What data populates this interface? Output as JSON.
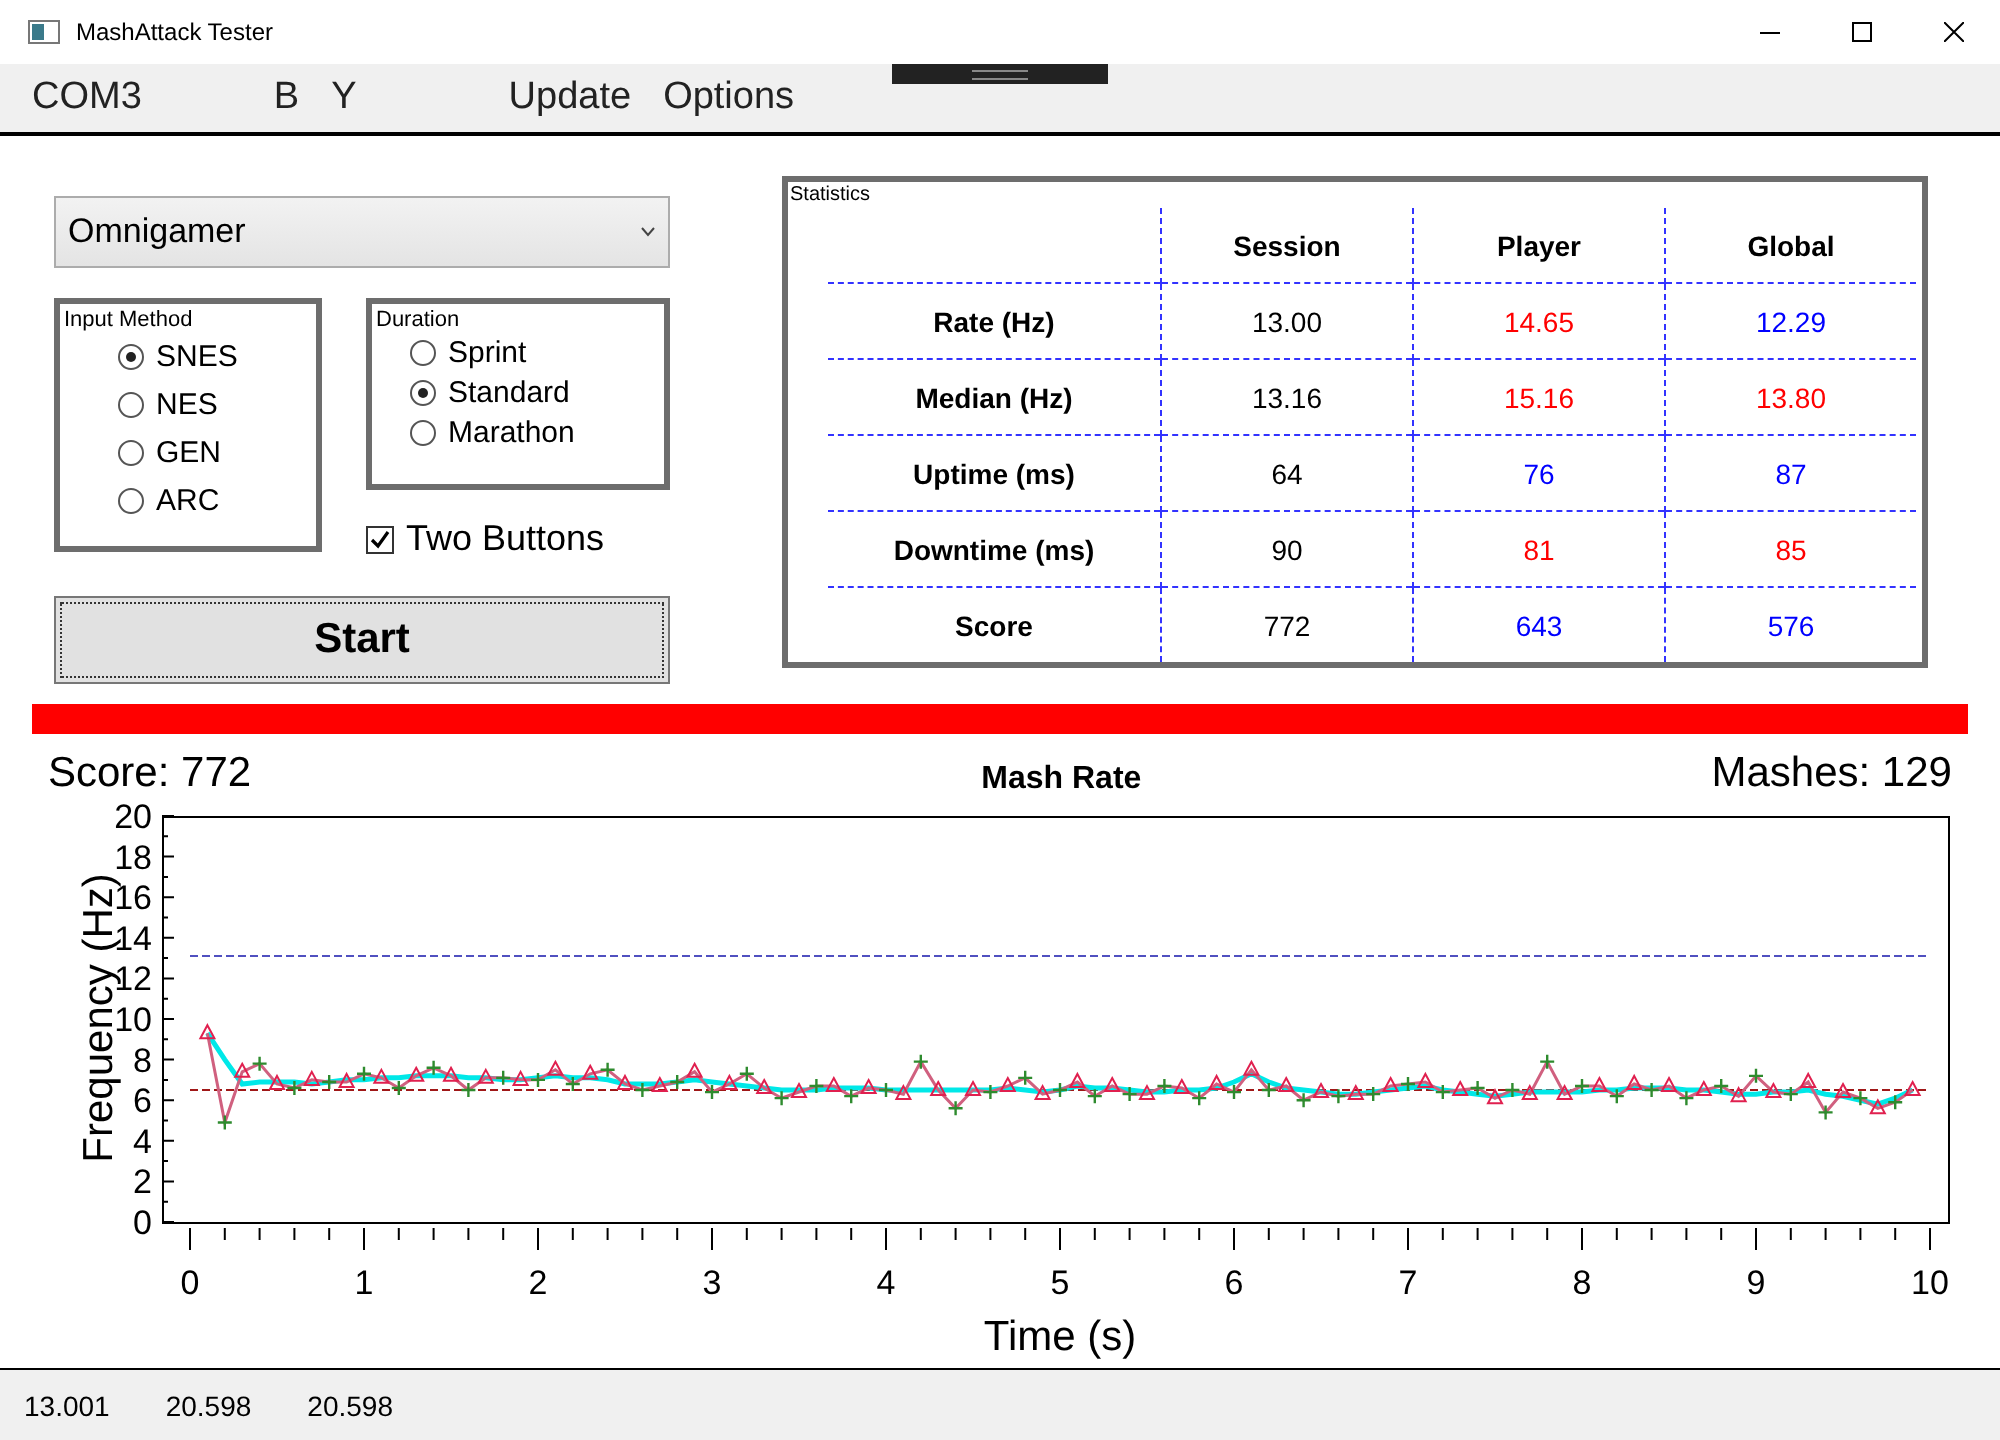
{
  "window": {
    "title": "MashAttack Tester"
  },
  "menu": [
    {
      "label": "COM3"
    },
    {
      "label": "B"
    },
    {
      "label": "Y"
    },
    {
      "label": "Update"
    },
    {
      "label": "Options"
    }
  ],
  "player_select": {
    "value": "Omnigamer"
  },
  "input_method": {
    "title": "Input Method",
    "options": [
      {
        "label": "SNES",
        "selected": true
      },
      {
        "label": "NES",
        "selected": false
      },
      {
        "label": "GEN",
        "selected": false
      },
      {
        "label": "ARC",
        "selected": false
      }
    ]
  },
  "duration": {
    "title": "Duration",
    "options": [
      {
        "label": "Sprint",
        "selected": false
      },
      {
        "label": "Standard",
        "selected": true
      },
      {
        "label": "Marathon",
        "selected": false
      }
    ]
  },
  "two_buttons": {
    "label": "Two Buttons",
    "checked": true
  },
  "start_button": {
    "label": "Start"
  },
  "statistics": {
    "title": "Statistics",
    "columns": [
      "Session",
      "Player",
      "Global"
    ],
    "rows": [
      {
        "label": "Rate (Hz)",
        "cells": [
          {
            "text": "13.00",
            "color": "#000000"
          },
          {
            "text": "14.65",
            "color": "#ff0000"
          },
          {
            "text": "12.29",
            "color": "#0000ff"
          }
        ]
      },
      {
        "label": "Median (Hz)",
        "cells": [
          {
            "text": "13.16",
            "color": "#000000"
          },
          {
            "text": "15.16",
            "color": "#ff0000"
          },
          {
            "text": "13.80",
            "color": "#ff0000"
          }
        ]
      },
      {
        "label": "Uptime (ms)",
        "cells": [
          {
            "text": "64",
            "color": "#000000"
          },
          {
            "text": "76",
            "color": "#0000ff"
          },
          {
            "text": "87",
            "color": "#0000ff"
          }
        ]
      },
      {
        "label": "Downtime (ms)",
        "cells": [
          {
            "text": "90",
            "color": "#000000"
          },
          {
            "text": "81",
            "color": "#ff0000"
          },
          {
            "text": "85",
            "color": "#ff0000"
          }
        ]
      },
      {
        "label": "Score",
        "cells": [
          {
            "text": "772",
            "color": "#000000"
          },
          {
            "text": "643",
            "color": "#0000ff"
          },
          {
            "text": "576",
            "color": "#0000ff"
          }
        ]
      }
    ]
  },
  "progress": {
    "level": 1
  },
  "chart": {
    "score": "Score: 772",
    "mashes": "Mashes: 129",
    "chart_data": {
      "type": "line",
      "title": "Mash Rate",
      "xlabel": "Time (s)",
      "ylabel": "Frequency (Hz)",
      "xlim": [
        0,
        10
      ],
      "ylim": [
        0,
        20
      ],
      "xticks": [
        0,
        1,
        2,
        3,
        4,
        5,
        6,
        7,
        8,
        9,
        10
      ],
      "yticks": [
        0,
        2,
        4,
        6,
        8,
        10,
        12,
        14,
        16,
        18,
        20
      ],
      "x": [
        0.1,
        0.2,
        0.3,
        0.4,
        0.5,
        0.6,
        0.7,
        0.8,
        0.9,
        1.0,
        1.1,
        1.2,
        1.3,
        1.4,
        1.5,
        1.6,
        1.7,
        1.8,
        1.9,
        2.0,
        2.1,
        2.2,
        2.3,
        2.4,
        2.5,
        2.6,
        2.7,
        2.8,
        2.9,
        3.0,
        3.1,
        3.2,
        3.3,
        3.4,
        3.5,
        3.6,
        3.7,
        3.8,
        3.9,
        4.0,
        4.1,
        4.2,
        4.3,
        4.4,
        4.5,
        4.6,
        4.7,
        4.8,
        4.9,
        5.0,
        5.1,
        5.2,
        5.3,
        5.4,
        5.5,
        5.6,
        5.7,
        5.8,
        5.9,
        6.0,
        6.1,
        6.2,
        6.3,
        6.4,
        6.5,
        6.6,
        6.7,
        6.8,
        6.9,
        7.0,
        7.1,
        7.2,
        7.3,
        7.4,
        7.5,
        7.6,
        7.7,
        7.8,
        7.9,
        8.0,
        8.1,
        8.2,
        8.3,
        8.4,
        8.5,
        8.6,
        8.7,
        8.8,
        8.9,
        9.0,
        9.1,
        9.2,
        9.3,
        9.4,
        9.5,
        9.6,
        9.7,
        9.8,
        9.9
      ],
      "series": [
        {
          "color": "#00e8e8",
          "values": [
            9.3,
            8.0,
            6.8,
            6.9,
            6.9,
            6.9,
            6.8,
            6.9,
            7.0,
            7.0,
            7.1,
            7.1,
            7.2,
            7.2,
            7.2,
            7.1,
            7.1,
            7.0,
            7.0,
            7.1,
            7.2,
            7.1,
            7.1,
            7.0,
            6.8,
            6.8,
            6.8,
            6.9,
            7.0,
            6.9,
            6.8,
            6.7,
            6.6,
            6.5,
            6.5,
            6.5,
            6.6,
            6.6,
            6.6,
            6.5,
            6.5,
            6.5,
            6.5,
            6.5,
            6.5,
            6.5,
            6.6,
            6.5,
            6.4,
            6.5,
            6.7,
            6.6,
            6.6,
            6.5,
            6.4,
            6.4,
            6.5,
            6.5,
            6.6,
            6.9,
            7.3,
            6.9,
            6.6,
            6.5,
            6.4,
            6.3,
            6.3,
            6.4,
            6.5,
            6.6,
            6.7,
            6.5,
            6.4,
            6.3,
            6.2,
            6.3,
            6.4,
            6.4,
            6.4,
            6.4,
            6.5,
            6.5,
            6.6,
            6.6,
            6.6,
            6.5,
            6.5,
            6.4,
            6.3,
            6.3,
            6.4,
            6.4,
            6.5,
            6.3,
            6.2,
            6.0,
            5.8,
            6.1,
            6.5
          ]
        },
        {
          "color": "#d0607f",
          "values": [
            9.3,
            4.9,
            7.4,
            7.8,
            6.8,
            6.6,
            7.0,
            6.9,
            6.9,
            7.3,
            7.1,
            6.6,
            7.2,
            7.6,
            7.2,
            6.5,
            7.1,
            7.1,
            7.0,
            7.0,
            7.5,
            6.8,
            7.3,
            7.5,
            6.8,
            6.5,
            6.7,
            6.9,
            7.4,
            6.4,
            6.8,
            7.3,
            6.6,
            6.1,
            6.4,
            6.7,
            6.7,
            6.2,
            6.6,
            6.5,
            6.3,
            7.9,
            6.5,
            5.6,
            6.5,
            6.4,
            6.7,
            7.1,
            6.3,
            6.5,
            6.9,
            6.2,
            6.7,
            6.3,
            6.3,
            6.7,
            6.6,
            6.1,
            6.8,
            6.4,
            7.5,
            6.5,
            6.7,
            6.0,
            6.4,
            6.2,
            6.3,
            6.3,
            6.7,
            6.8,
            6.9,
            6.4,
            6.5,
            6.6,
            6.1,
            6.5,
            6.3,
            7.9,
            6.3,
            6.7,
            6.7,
            6.2,
            6.8,
            6.5,
            6.7,
            6.1,
            6.5,
            6.7,
            6.2,
            7.2,
            6.4,
            6.3,
            6.9,
            5.4,
            6.4,
            6.1,
            5.6,
            5.9,
            6.5
          ]
        }
      ],
      "ref_lines": [
        {
          "axis": "y",
          "value": 13.1,
          "color": "#5050c0"
        },
        {
          "axis": "y",
          "value": 6.5,
          "color": "#a01818"
        }
      ]
    }
  },
  "status_bar": [
    "13.001",
    "20.598",
    "20.598"
  ]
}
